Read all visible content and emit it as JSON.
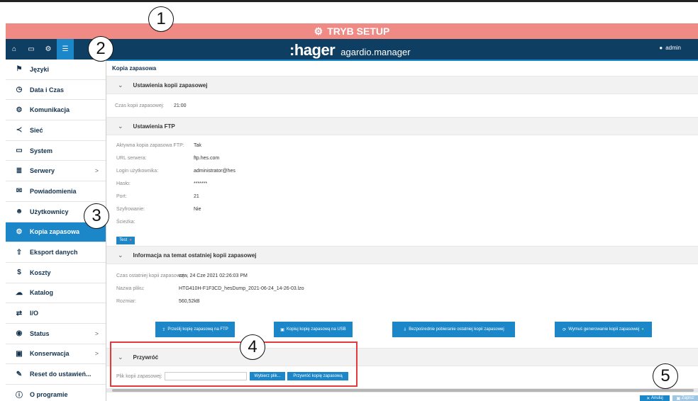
{
  "setup_bar": {
    "label": "TRYB SETUP"
  },
  "header": {
    "brand_logo": ":hager",
    "brand_name": "agardio.manager",
    "user": "admin",
    "nav_icons": [
      "home-icon",
      "monitor-icon",
      "gears-icon",
      "sliders-icon"
    ]
  },
  "sidebar": {
    "items": [
      {
        "label": "Języki",
        "icon": "flag-icon"
      },
      {
        "label": "Data i Czas",
        "icon": "clock-icon"
      },
      {
        "label": "Komunikacja",
        "icon": "gears-icon"
      },
      {
        "label": "Sieć",
        "icon": "share-icon"
      },
      {
        "label": "System",
        "icon": "hdd-icon"
      },
      {
        "label": "Serwery",
        "icon": "server-icon",
        "has_submenu": true
      },
      {
        "label": "Powiadomienia",
        "icon": "envelope-icon"
      },
      {
        "label": "Użytkownicy",
        "icon": "users-icon"
      },
      {
        "label": "Kopia zapasowa",
        "icon": "gears-icon",
        "active": true
      },
      {
        "label": "Eksport danych",
        "icon": "upload-icon"
      },
      {
        "label": "Koszty",
        "icon": "dollar-icon"
      },
      {
        "label": "Katalog",
        "icon": "cloud-icon"
      },
      {
        "label": "I/O",
        "icon": "exchange-icon"
      },
      {
        "label": "Status",
        "icon": "eye-icon",
        "has_submenu": true
      },
      {
        "label": "Konserwacja",
        "icon": "toolbox-icon",
        "has_submenu": true
      },
      {
        "label": "Reset do ustawień...",
        "icon": "wrench-icon"
      },
      {
        "label": "O programie",
        "icon": "info-icon"
      }
    ],
    "chevron": ">"
  },
  "main": {
    "breadcrumb": "Kopia zapasowa",
    "section1": {
      "title": "Ustawienia kopii zapasowej",
      "rows": [
        {
          "label": "Czas kopii zapasowej:",
          "value": "21:00"
        }
      ]
    },
    "section2": {
      "title": "Ustawienia FTP",
      "rows": [
        {
          "label": "Aktywna kopia zapasowa FTP:",
          "value": "Tak"
        },
        {
          "label": "URL serwera:",
          "value": "ftp.hes.com"
        },
        {
          "label": "Login użytkownika:",
          "value": "administrator@hes"
        },
        {
          "label": "Hasło:",
          "value": "*******"
        },
        {
          "label": "Port:",
          "value": "21"
        },
        {
          "label": "Szyfrowanie:",
          "value": "Nie"
        },
        {
          "label": "Ścieżka:",
          "value": ""
        }
      ],
      "test_button": "Test"
    },
    "section3": {
      "title": "Informacja na temat ostatniej kopii zapasowej",
      "rows": [
        {
          "label": "Czas ostatniej kopii zapasowej:",
          "value": "czw, 24 Cze 2021 02:26:03 PM"
        },
        {
          "label": "Nazwa pliku:",
          "value": "HTG410H-F1F3CD_hesDump_2021-06-24_14-26-03.lzo"
        },
        {
          "label": "Rozmiar:",
          "value": "560,52kB"
        }
      ]
    },
    "actions": {
      "ftp": "Prześlij kopię zapasową na FTP",
      "usb": "Kopiuj kopię zapasową na USB",
      "download": "Bezpośrednie pobieranie ostatniej kopii zapasowej",
      "force": "Wymuś generowanie kopii zapasowej"
    },
    "restore": {
      "title": "Przywróć",
      "label": "Plik kopii zapasowej:",
      "file_value": "",
      "choose_button": "Wybierz plik...",
      "restore_button": "Przywróć kopię zapasową"
    },
    "bottom": {
      "cancel": "Anuluj",
      "save": "Zapisz"
    }
  },
  "callouts": [
    "1",
    "2",
    "3",
    "4",
    "5"
  ],
  "colors": {
    "accent": "#1b86c8",
    "header": "#0f3e63",
    "setup": "#f08a85",
    "highlight": "#e23b3b"
  }
}
